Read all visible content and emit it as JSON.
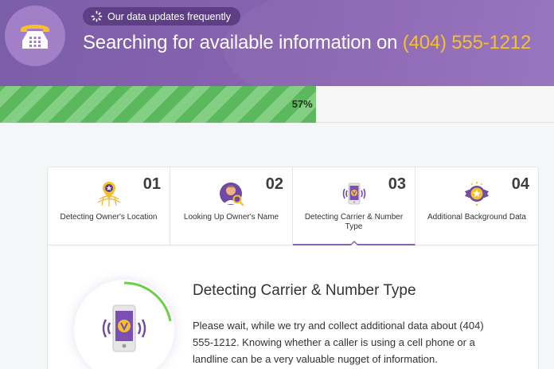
{
  "header": {
    "badge_text": "Our data updates frequently",
    "title_prefix": "Searching for available information on",
    "phone_number": "(404) 555-1212",
    "accent_color": "#f5c02c",
    "logo_icon": "telephone-icon"
  },
  "progress": {
    "percent": 57,
    "label": "57%"
  },
  "steps": [
    {
      "number": "01",
      "label": "Detecting Owner's Location",
      "icon": "location-pin-icon",
      "active": false
    },
    {
      "number": "02",
      "label": "Looking Up Owner's Name",
      "icon": "person-search-icon",
      "active": false
    },
    {
      "number": "03",
      "label": "Detecting Carrier & Number Type",
      "icon": "mobile-signal-icon",
      "active": true
    },
    {
      "number": "04",
      "label": "Additional Background Data",
      "icon": "award-badge-icon",
      "active": false
    }
  ],
  "detail": {
    "title": "Detecting Carrier & Number Type",
    "text": "Please wait, while we try and collect additional data about (404) 555-1212. Knowing whether a caller is using a cell phone or a landline can be a very valuable nugget of information.",
    "icon": "mobile-signal-icon",
    "ring_progress": 0.22
  }
}
